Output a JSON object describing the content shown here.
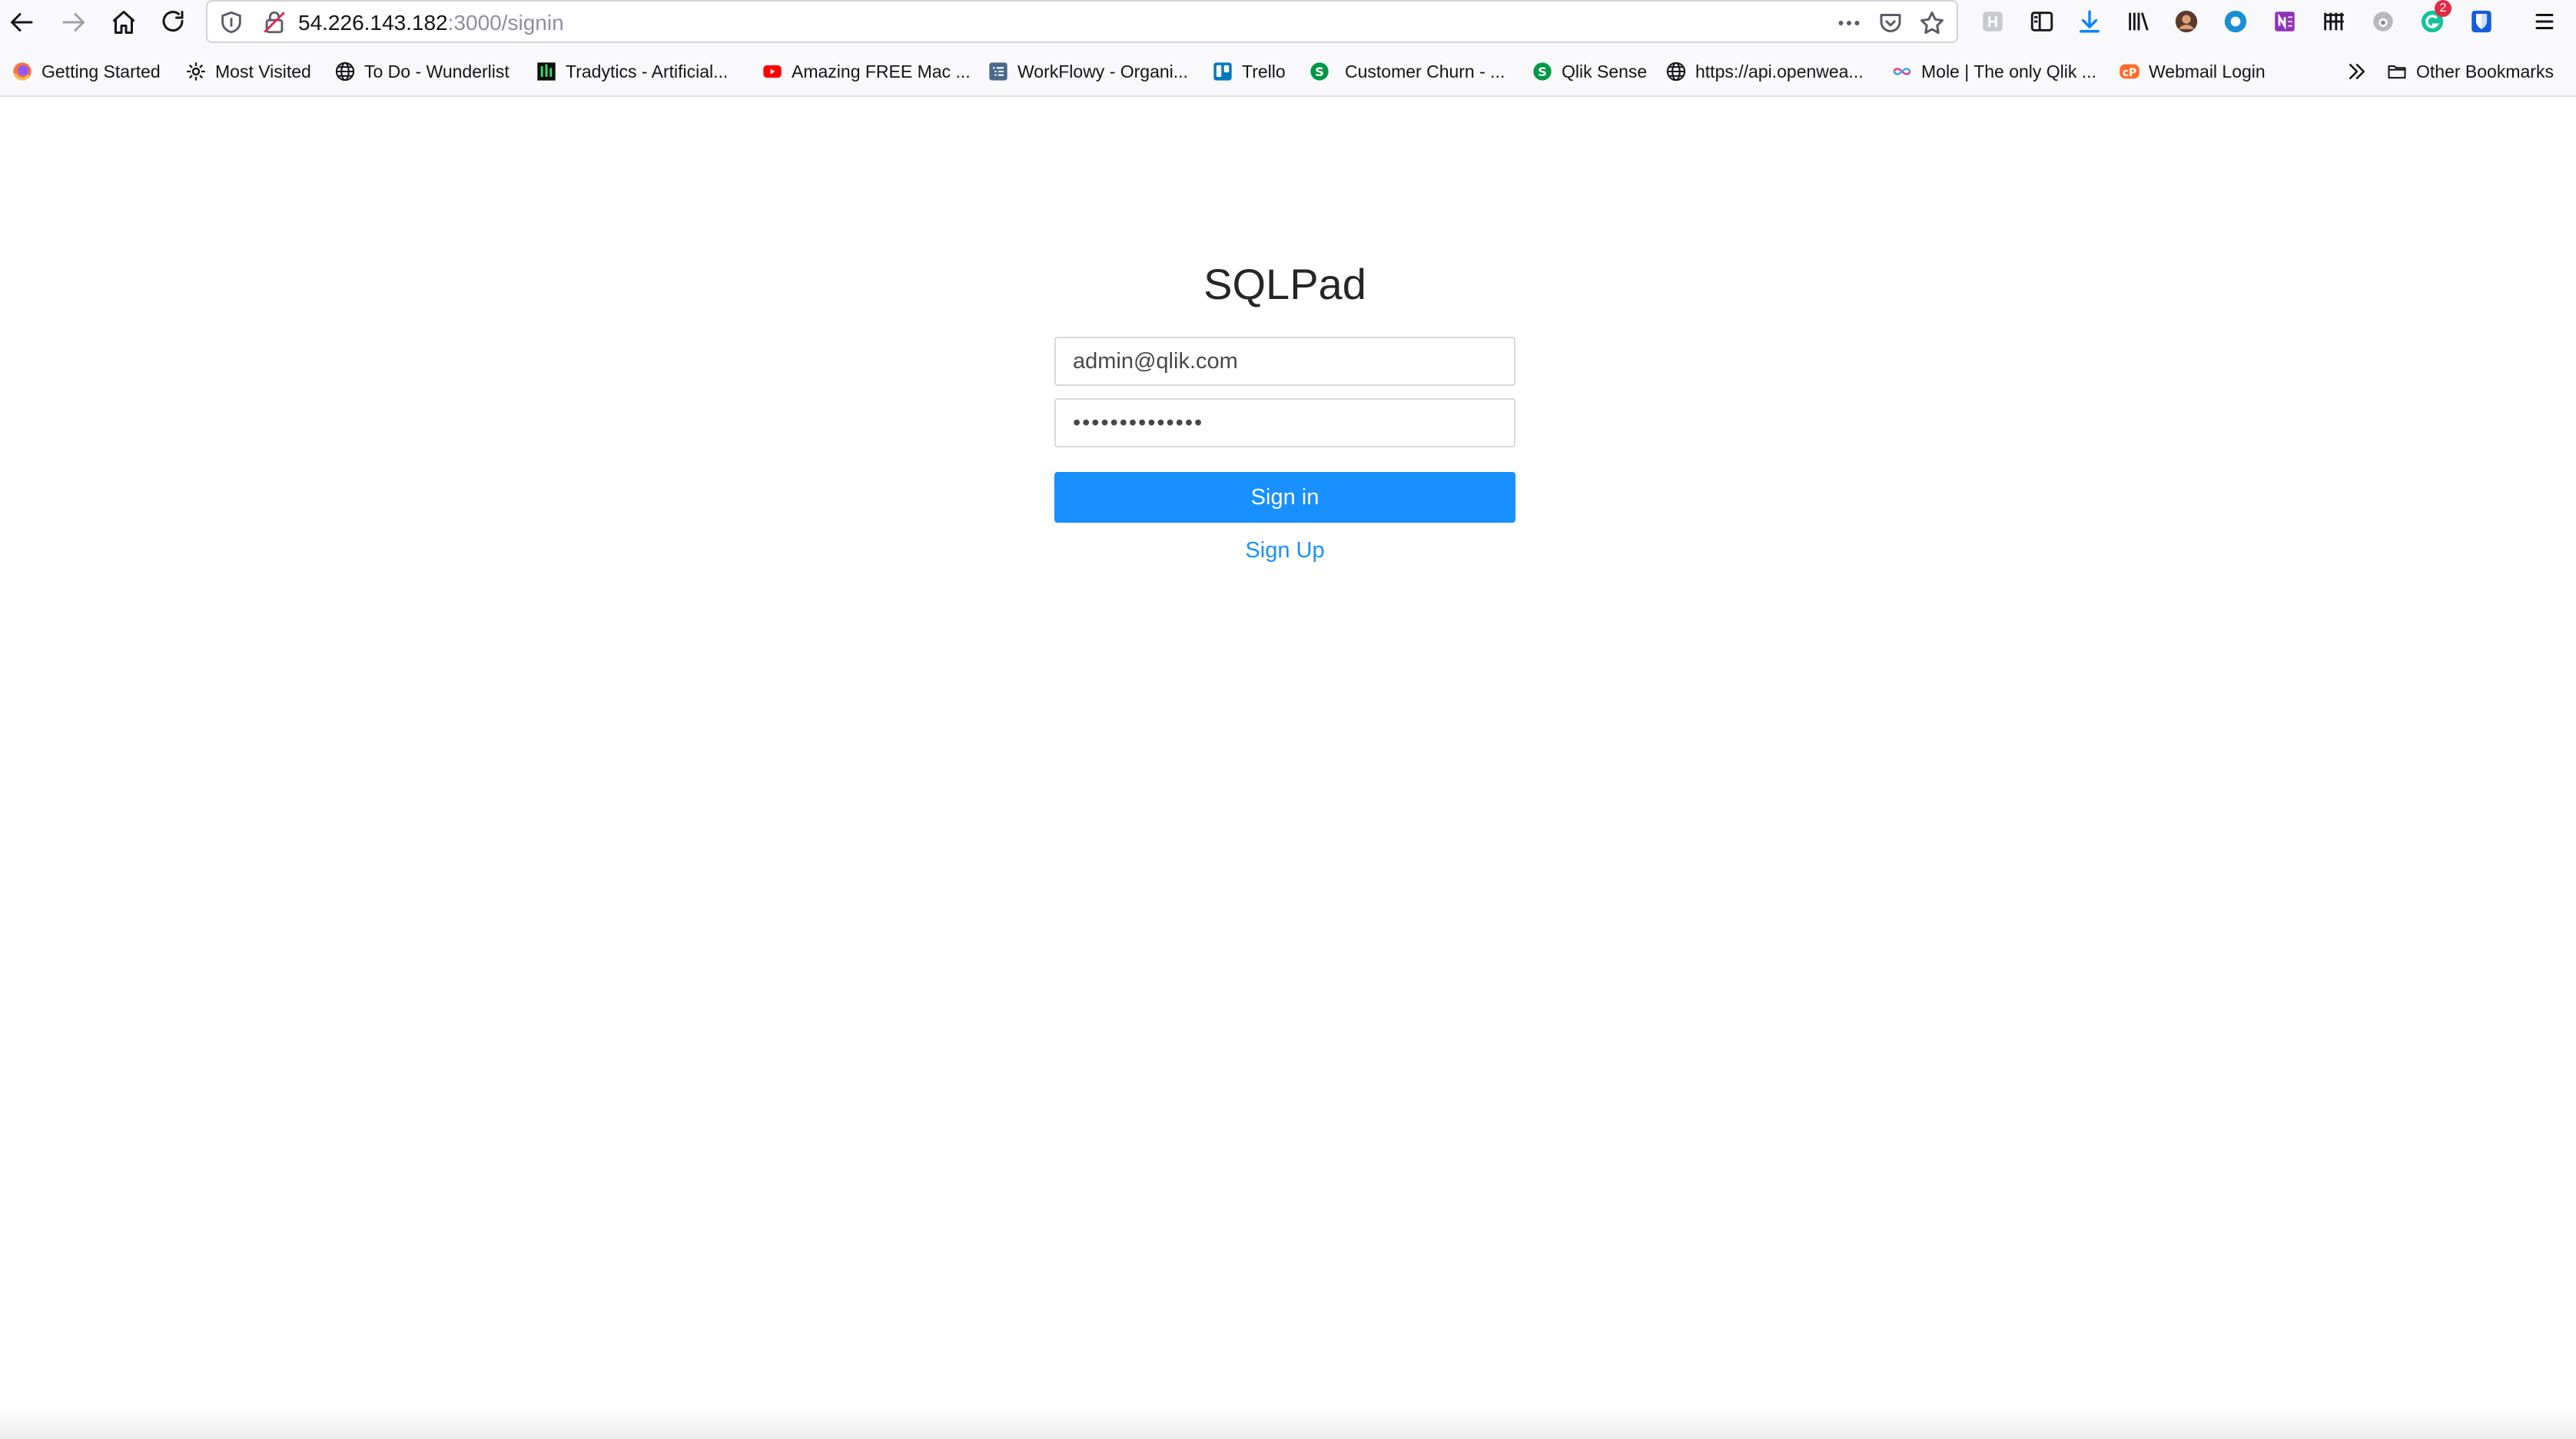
{
  "browser": {
    "url_host": "54.226.143.182",
    "url_path": ":3000/signin",
    "downloads_badge": "2",
    "accent_color": "#0a84ff"
  },
  "bookmarks": {
    "items": [
      {
        "label": "Getting Started",
        "icon": "firefox-icon"
      },
      {
        "label": "Most Visited",
        "icon": "gear-icon"
      },
      {
        "label": "To Do - Wunderlist",
        "icon": "globe-icon"
      },
      {
        "label": "Tradytics - Artificial...",
        "icon": "tradytics-icon"
      },
      {
        "label": "Amazing FREE Mac ...",
        "icon": "youtube-icon"
      },
      {
        "label": "WorkFlowy - Organi...",
        "icon": "workflowy-icon"
      },
      {
        "label": "Trello",
        "icon": "trello-icon"
      },
      {
        "label": "Customer Churn - ...",
        "icon": "qlik-icon"
      },
      {
        "label": "Qlik Sense",
        "icon": "qlik-icon"
      },
      {
        "label": "https://api.openwea...",
        "icon": "globe-icon"
      },
      {
        "label": "Mole | The only Qlik ...",
        "icon": "mole-icon"
      },
      {
        "label": "Webmail Login",
        "icon": "cpanel-icon"
      }
    ],
    "other_label": "Other Bookmarks"
  },
  "signin": {
    "title": "SQLPad",
    "email_value": "admin@qlik.com",
    "password_value": "••••••••••••••",
    "signin_label": "Sign in",
    "signup_label": "Sign Up",
    "primary_color": "#1890ff"
  }
}
